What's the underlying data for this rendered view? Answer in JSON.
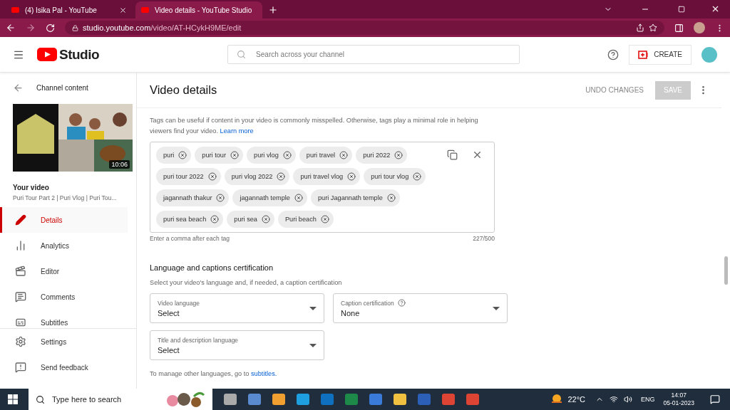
{
  "browser": {
    "tabs": [
      {
        "label": "(4) Isika Pal - YouTube",
        "selected": false
      },
      {
        "label": "Video details - YouTube Studio",
        "selected": true
      }
    ],
    "url_host": "studio.youtube.com",
    "url_path": "/video/AT-HCykH9ME/edit"
  },
  "header": {
    "logo": "Studio",
    "search": {
      "placeholder": "Search across your channel"
    },
    "create": "CREATE"
  },
  "sidebar": {
    "back": "Channel content",
    "duration": "10:06",
    "your_video": "Your video",
    "video_title": "Puri Tour Part 2 | Puri Vlog | Puri Tou...",
    "items": [
      {
        "label": "Details",
        "selected": true
      },
      {
        "label": "Analytics",
        "selected": false
      },
      {
        "label": "Editor",
        "selected": false
      },
      {
        "label": "Comments",
        "selected": false
      },
      {
        "label": "Subtitles",
        "selected": false
      }
    ],
    "footer": [
      {
        "label": "Settings"
      },
      {
        "label": "Send feedback"
      }
    ]
  },
  "page": {
    "title": "Video details",
    "undo": "UNDO CHANGES",
    "save": "SAVE",
    "save_disabled": true,
    "tags_help": "Tags can be useful if content in your video is commonly misspelled. Otherwise, tags play a minimal role in helping viewers find your video.",
    "learn_more": "Learn more",
    "tags": [
      "puri",
      "puri tour",
      "puri vlog",
      "puri travel",
      "puri 2022",
      "puri tour 2022",
      "puri vlog 2022",
      "puri travel vlog",
      "puri tour vlog",
      "jagannath thakur",
      "jagannath temple",
      "puri Jagannath temple",
      "puri sea beach",
      "puri sea",
      "Puri beach"
    ],
    "tags_hint": "Enter a comma after each tag",
    "tags_count": "227/500",
    "lang_title": "Language and captions certification",
    "lang_sub": "Select your video's language and, if needed, a caption certification",
    "selects": [
      {
        "label": "Video language",
        "value": "Select",
        "help": false
      },
      {
        "label": "Caption certification",
        "value": "None",
        "help": true
      },
      {
        "label": "Title and description language",
        "value": "Select",
        "help": false
      }
    ],
    "manage_text": "To manage other languages, go to",
    "manage_link": "subtitles."
  },
  "taskbar": {
    "search": "Type here to search",
    "temp": "22°C",
    "lang": "ENG",
    "time": "14:07",
    "date": "05-01-2023"
  }
}
